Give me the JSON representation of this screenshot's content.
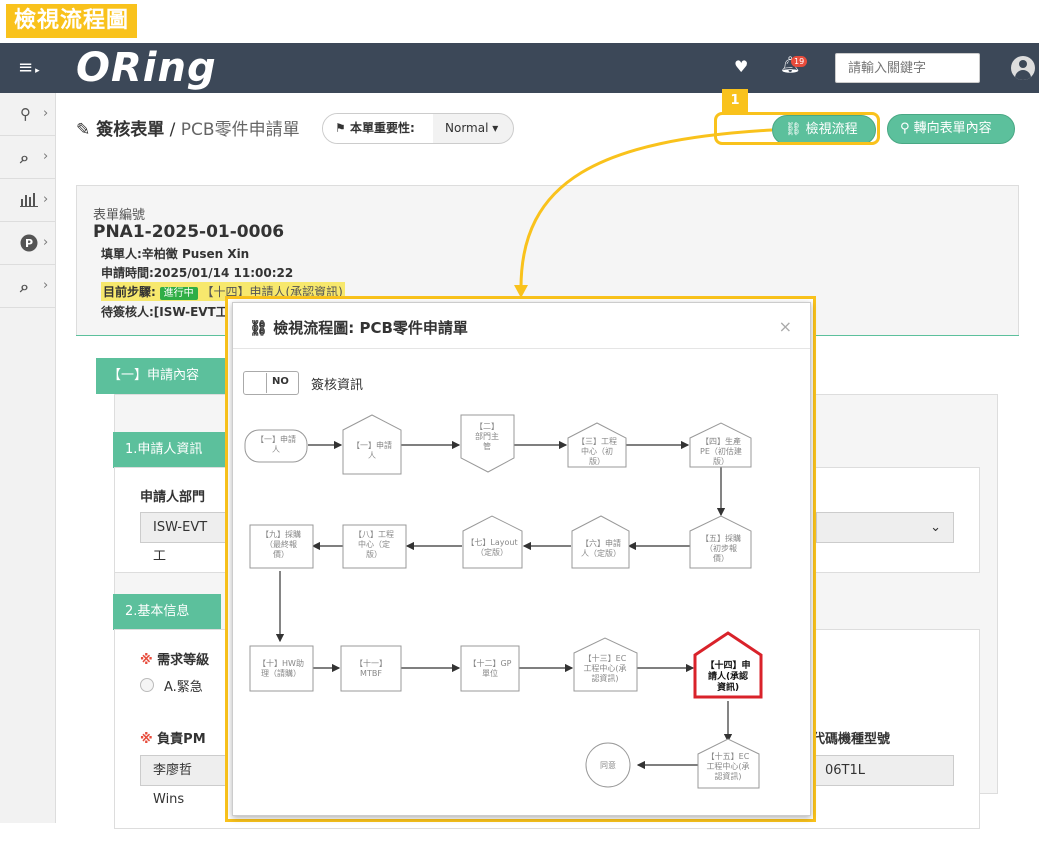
{
  "doc_title": "檢視流程圖",
  "navbar": {
    "menu_icon": "≡ ▸",
    "logo": "ORing",
    "notification_count": "19",
    "search_placeholder": "請輸入關鍵字"
  },
  "sidebar": {
    "items": [
      {
        "icon": "lightbulb-icon",
        "glyph": "💡"
      },
      {
        "icon": "search-icon",
        "glyph": "🔍"
      },
      {
        "icon": "bar-chart-icon",
        "glyph": "📊"
      },
      {
        "icon": "p-circle-icon",
        "glyph": "Ⓟ"
      },
      {
        "icon": "search-icon",
        "glyph": "🔍"
      }
    ]
  },
  "page": {
    "title_bold": "簽核表單",
    "title_sep": " / ",
    "title_sub": "PCB零件申請單",
    "importance_label": "本單重要性:",
    "importance_value": "Normal",
    "btn_flow": "檢視流程圖",
    "btn_form": "轉向表單內容頁",
    "callout_number": "1"
  },
  "form": {
    "number_label": "表單編號",
    "number": "PNA1-2025-01-0006",
    "filler": "填單人:辛柏徵 Pusen Xin",
    "apply_time": "申請時間:2025/01/14 11:00:22",
    "step_label": "目前步驟:",
    "step_status": "進行中",
    "step_name": "【十四】申請人(承認資訊)",
    "pending": "待簽核人:[ISW-EVT工",
    "section1_tab": "【一】申請內容",
    "sub1_tab": "1.申請人資訊",
    "dept_label": "申請人部門",
    "dept_value": "ISW-EVT工",
    "sub2_tab": "2.基本信息",
    "level_label": "需求等級",
    "level_option": "A.緊急",
    "pm_label": "負責PM",
    "pm_value": "李廖哲 Wins",
    "model_label": "代碼機種型號",
    "model_value": "06T1L",
    "req_mark": "※"
  },
  "modal": {
    "title": "檢視流程圖: PCB零件申請單",
    "close": "×",
    "toggle_text": "NO",
    "toggle_label": "簽核資訊",
    "nodes": [
      {
        "id": "n1",
        "lines": [
          "【一】申請",
          "人"
        ]
      },
      {
        "id": "n2",
        "lines": [
          "【一】申請",
          "人"
        ]
      },
      {
        "id": "n3",
        "lines": [
          "【二】",
          "部門主",
          "管"
        ]
      },
      {
        "id": "n4",
        "lines": [
          "【三】工程",
          "中心（初",
          "版）"
        ]
      },
      {
        "id": "n5",
        "lines": [
          "【四】生產",
          "PE（初估建",
          "版）"
        ]
      },
      {
        "id": "n6",
        "lines": [
          "【五】採購",
          "（初步報",
          "價）"
        ]
      },
      {
        "id": "n7",
        "lines": [
          "【六】申請",
          "人（定版）"
        ]
      },
      {
        "id": "n8",
        "lines": [
          "【七】Layout",
          "（定版）"
        ]
      },
      {
        "id": "n9",
        "lines": [
          "【八】工程",
          "中心（定",
          "版）"
        ]
      },
      {
        "id": "n10",
        "lines": [
          "【九】採購",
          "（最終報",
          "價）"
        ]
      },
      {
        "id": "n11",
        "lines": [
          "【十】HW助",
          "理（請購）"
        ]
      },
      {
        "id": "n12",
        "lines": [
          "【十一】",
          "MTBF"
        ]
      },
      {
        "id": "n13",
        "lines": [
          "【十二】GP",
          "單位"
        ]
      },
      {
        "id": "n14",
        "lines": [
          "【十三】EC",
          "工程中心(承",
          "認資訊)"
        ]
      },
      {
        "id": "n15",
        "lines": [
          "【十四】申",
          "請人(承認",
          "資訊)"
        ]
      },
      {
        "id": "n16",
        "lines": [
          "【十五】EC",
          "工程中心(承",
          "認資訊)"
        ]
      },
      {
        "id": "n17",
        "lines": [
          "同意"
        ]
      }
    ]
  }
}
